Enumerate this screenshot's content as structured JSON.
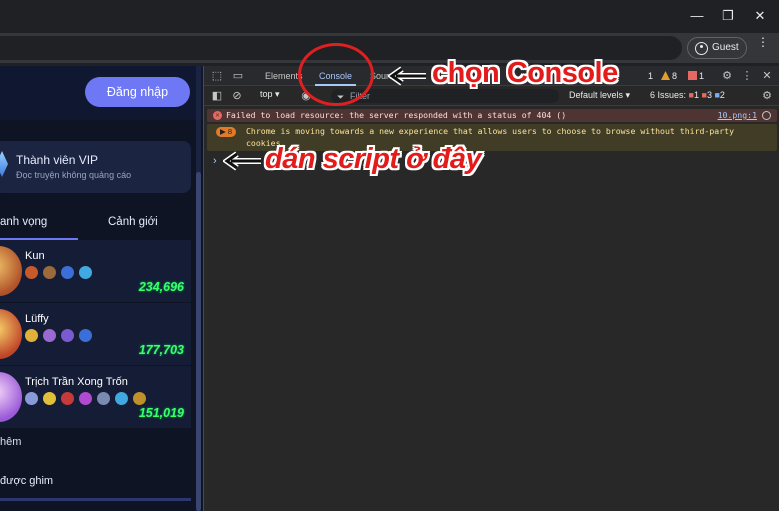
{
  "browser": {
    "window_controls": {
      "minimize": "—",
      "restore": "❐",
      "close": "✕"
    },
    "profile_label": "Guest",
    "menu_icon": "⋮"
  },
  "site": {
    "login_button": "Đăng nhập",
    "vip": {
      "title": "Thành viên VIP",
      "subtitle": "Đọc truyện không quảng cáo"
    },
    "tabs": [
      "anh vọng",
      "Cảnh giới"
    ],
    "ranking": [
      {
        "name": "Kun",
        "score": "234,696",
        "badge_colors": [
          "#c85a2a",
          "#9a6a3a",
          "#3b6fd8",
          "#3fa9e0"
        ],
        "avatar_color": "#d79a3c"
      },
      {
        "name": "Lüffy",
        "score": "177,703",
        "badge_colors": [
          "#e0b13a",
          "#9a6ad0",
          "#7a5ad0",
          "#3b6fd8"
        ],
        "avatar_color": "#e07a3a"
      },
      {
        "name": "Trịch Trần Xong Trốn",
        "score": "151,019",
        "badge_colors": [
          "#8a9ad8",
          "#e0c03a",
          "#c83a3a",
          "#b04ad0",
          "#7a8ab0",
          "#3fa9e0",
          "#c0902a"
        ],
        "avatar_color": "#c07ad8"
      }
    ],
    "more_text": "hêm",
    "pinned_text": "được ghim"
  },
  "devtools": {
    "tabs": [
      "Elements",
      "Console",
      "Sources"
    ],
    "active_tab": "Console",
    "counts": {
      "errors": "1",
      "warnings": "8",
      "messages": "1"
    },
    "context": "top",
    "filter_placeholder": "Filter",
    "levels": "Default levels",
    "issues": {
      "label": "6 Issues:",
      "errors": "1",
      "warnings": "3",
      "info": "2"
    },
    "error_message": "Failed to load resource: the server responded with a status of 404 ()",
    "error_source": "10.png:1",
    "warning_count": "8",
    "warning_message": "Chrome is moving towards a new experience that allows users to choose to browse without third-party cookies.",
    "prompt_symbol": "›"
  },
  "annotations": {
    "console_label": "chọn Console",
    "script_label": "dán script ở đây",
    "color": "#e41b1b"
  }
}
